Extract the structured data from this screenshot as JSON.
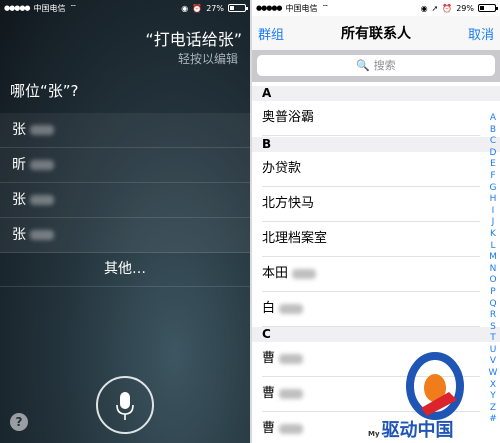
{
  "siri": {
    "status": {
      "dots": "●●●●●",
      "carrier": "中国电信",
      "wifi": "⌔",
      "battery": "27%",
      "battery_level": 0.27
    },
    "command": "“打电话给张”",
    "edit_hint": "轻按以编辑",
    "question": "哪位“张”?",
    "options": [
      "张",
      "昕",
      "张",
      "张"
    ],
    "more": "其他…",
    "help": "?"
  },
  "contacts": {
    "status": {
      "dots": "●●●●●",
      "carrier": "中国电信",
      "wifi": "⌔",
      "battery": "29%",
      "battery_level": 0.29
    },
    "nav": {
      "left": "群组",
      "title": "所有联系人",
      "right": "取消"
    },
    "search_placeholder": "🔍 搜索",
    "sections": [
      {
        "letter": "A",
        "rows": [
          "奥普浴霸"
        ]
      },
      {
        "letter": "B",
        "rows": [
          "办贷款",
          "北方快马",
          "北理档案室",
          "本田",
          "白"
        ]
      },
      {
        "letter": "C",
        "rows": [
          "曹",
          "曹",
          "曹"
        ]
      }
    ],
    "index": [
      "A",
      "B",
      "C",
      "D",
      "E",
      "F",
      "G",
      "H",
      "I",
      "J",
      "K",
      "L",
      "M",
      "N",
      "O",
      "P",
      "Q",
      "R",
      "S",
      "T",
      "U",
      "V",
      "W",
      "X",
      "Y",
      "Z",
      "#"
    ]
  },
  "watermark": {
    "prefix": "My",
    "text": "驱动中国"
  },
  "colors": {
    "accent": "#1a7cf5",
    "siri_bg": "#24343d"
  }
}
